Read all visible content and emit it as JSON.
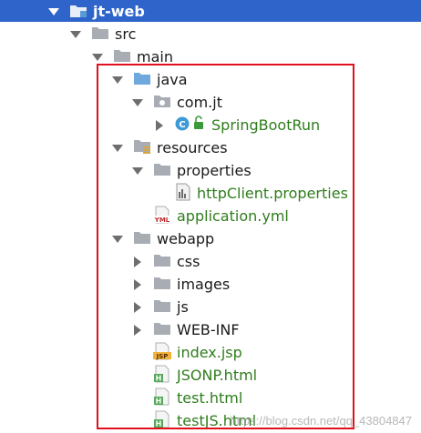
{
  "tree": {
    "project": "jt-web",
    "src": "src",
    "main": "main",
    "java": "java",
    "package": "com.jt",
    "class": "SpringBootRun",
    "resources": "resources",
    "properties_folder": "properties",
    "properties_file": "httpClient.properties",
    "app_yml": "application.yml",
    "webapp": "webapp",
    "css": "css",
    "images": "images",
    "js": "js",
    "webinf": "WEB-INF",
    "index_jsp": "index.jsp",
    "jsonp_html": "JSONP.html",
    "test_html": "test.html",
    "testjs_html": "testJS.html"
  },
  "icons": {
    "folder": "folder-icon",
    "source_folder": "source-folder-icon",
    "resources_folder": "resources-folder-icon",
    "package": "package-icon",
    "class": "spring-class-icon",
    "properties": "properties-file-icon",
    "yml": "yml-file-icon",
    "jsp": "jsp-file-icon",
    "html": "html-file-icon"
  },
  "badges": {
    "yml": "YML",
    "jsp": "JSP",
    "html": "H",
    "class": "C"
  },
  "watermark": "https://blog.csdn.net/qq_43804847",
  "colors": {
    "selection": "#2f65ca",
    "highlight_box": "#e0101c",
    "green_text": "#2f7d1c",
    "folder_gray": "#a8adb4",
    "java_folder": "#6fa8dc"
  }
}
